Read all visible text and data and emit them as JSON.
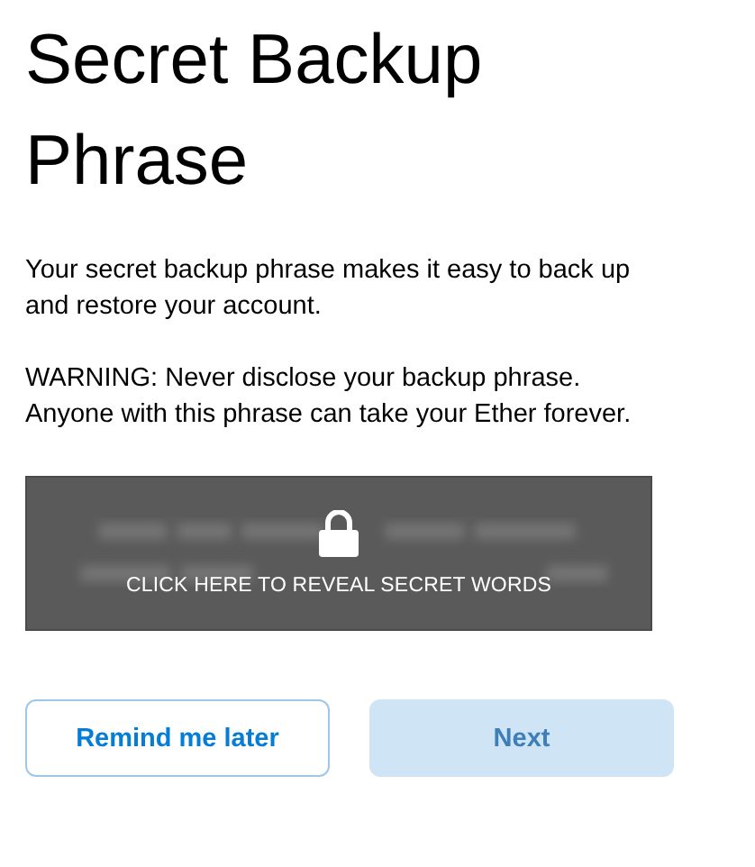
{
  "title": "Secret Backup Phrase",
  "paragraphs": [
    "Your secret backup phrase makes it easy to back up and restore your account.",
    "WARNING: Never disclose your backup phrase. Anyone with this phrase can take your Ether forever."
  ],
  "reveal": {
    "label": "CLICK HERE TO REVEAL SECRET WORDS"
  },
  "buttons": [
    {
      "label": "Remind me later",
      "kind": "secondary",
      "disabled": false
    },
    {
      "label": "Next",
      "kind": "primary",
      "disabled": true
    }
  ]
}
